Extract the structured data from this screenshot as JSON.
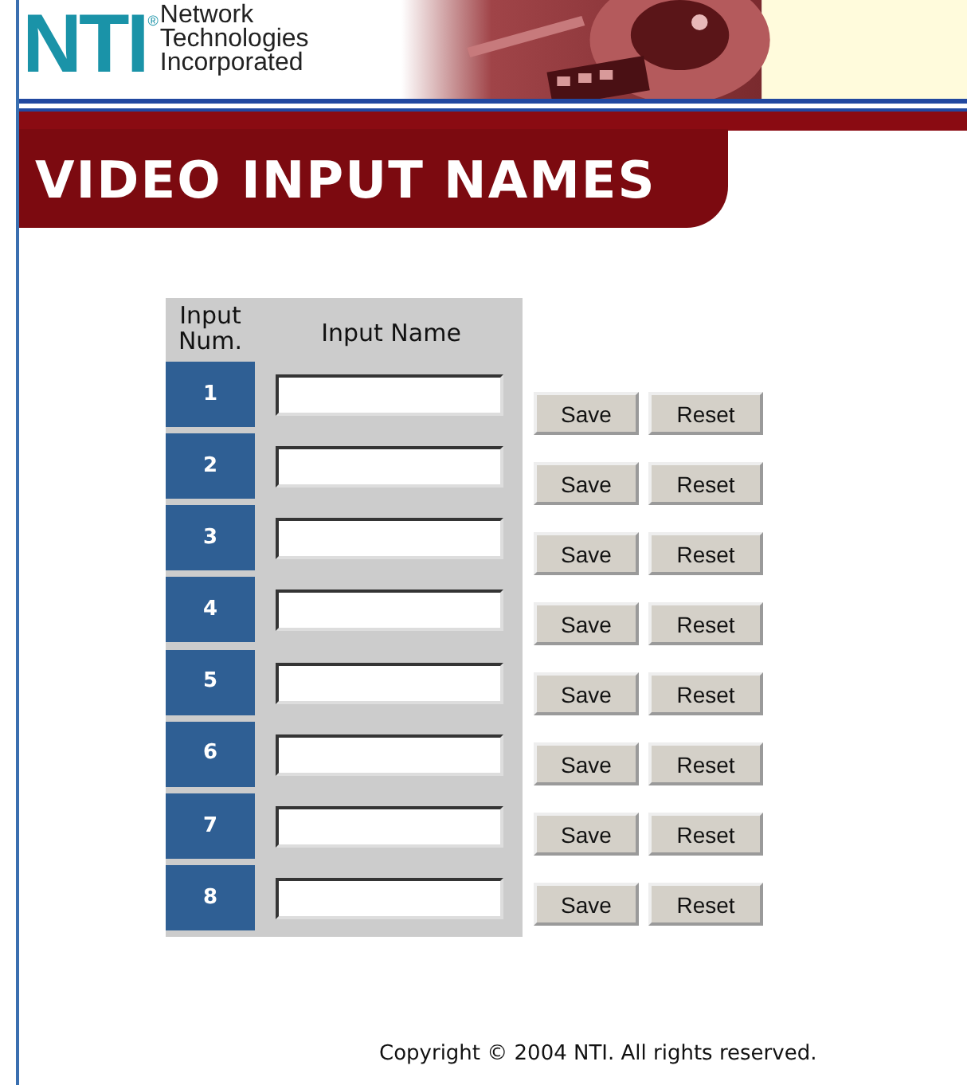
{
  "header": {
    "logo": "NTI",
    "registered": "®",
    "company": [
      "Network",
      "Technologies",
      "Incorporated"
    ]
  },
  "title": "VIDEO INPUT NAMES",
  "table": {
    "columns": [
      "Input Num.",
      "Input Name"
    ],
    "rows": [
      {
        "num": "1",
        "buttons": [
          "Save",
          "Reset"
        ]
      },
      {
        "num": "2",
        "buttons": [
          "Save",
          "Reset"
        ]
      },
      {
        "num": "3",
        "buttons": [
          "Save",
          "Reset"
        ]
      },
      {
        "num": "4",
        "buttons": [
          "Save",
          "Reset"
        ]
      },
      {
        "num": "5",
        "buttons": [
          "Save",
          "Reset"
        ]
      },
      {
        "num": "6",
        "buttons": [
          "Save",
          "Reset"
        ]
      },
      {
        "num": "7",
        "buttons": [
          "Save",
          "Reset"
        ]
      },
      {
        "num": "8",
        "buttons": [
          "Save",
          "Reset"
        ]
      }
    ]
  },
  "footer": "Copyright © 2004 NTI. All rights reserved."
}
